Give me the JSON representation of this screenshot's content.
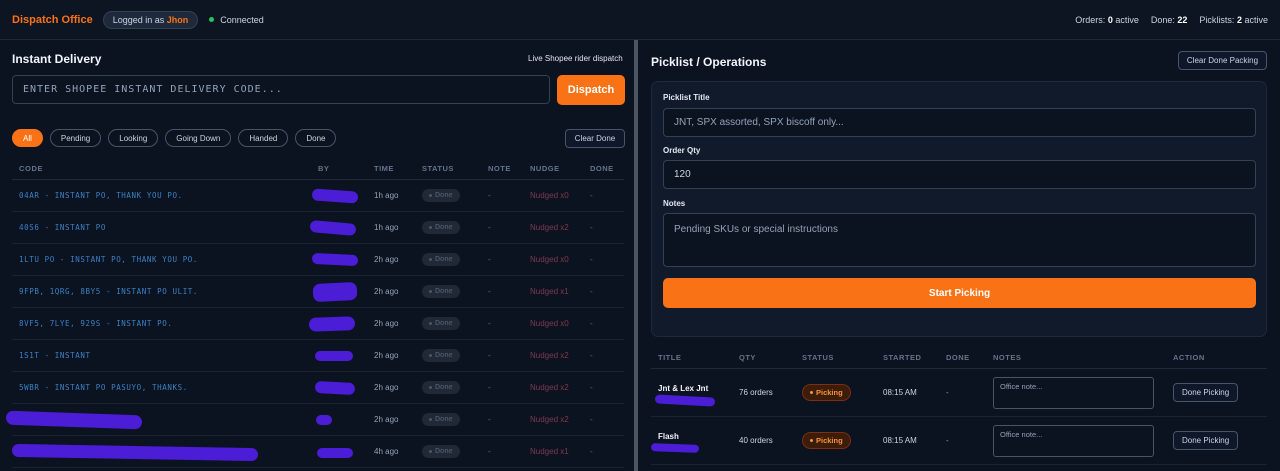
{
  "header": {
    "brand": "Dispatch Office",
    "login_prefix": "Logged in as",
    "user": "Jhon",
    "connection": "Connected",
    "orders_label": "Orders:",
    "orders_value": "0",
    "orders_suffix": "active",
    "done_label": "Done:",
    "done_value": "22",
    "picklists_label": "Picklists:",
    "picklists_value": "2",
    "picklists_suffix": "active"
  },
  "instant": {
    "title": "Instant Delivery",
    "subtitle": "Live Shopee rider dispatch",
    "placeholder": "ENTER SHOPEE INSTANT DELIVERY CODE...",
    "dispatch_label": "Dispatch",
    "filters": [
      "All",
      "Pending",
      "Looking",
      "Going Down",
      "Handed",
      "Done"
    ],
    "clear_done_label": "Clear Done",
    "columns": [
      "CODE",
      "BY",
      "TIME",
      "STATUS",
      "NOTE",
      "NUDGE",
      "DONE"
    ],
    "rows": [
      {
        "code": "04AR - INSTANT PO, THANK YOU PO.",
        "time": "1h ago",
        "status": "Done",
        "note": "-",
        "nudge": "Nudged x0",
        "done": "-"
      },
      {
        "code": "40S6 - INSTANT PO",
        "time": "1h ago",
        "status": "Done",
        "note": "-",
        "nudge": "Nudged x2",
        "done": "-"
      },
      {
        "code": "1LTU PO - INSTANT PO, THANK YOU PO.",
        "time": "2h ago",
        "status": "Done",
        "note": "-",
        "nudge": "Nudged x0",
        "done": "-"
      },
      {
        "code": "9FPB, 1QRG, 8BY5 - INSTANT PO ULIT.",
        "time": "2h ago",
        "status": "Done",
        "note": "-",
        "nudge": "Nudged x1",
        "done": "-"
      },
      {
        "code": "8VF5, 7LYE, 929S - INSTANT PO.",
        "time": "2h ago",
        "status": "Done",
        "note": "-",
        "nudge": "Nudged x0",
        "done": "-"
      },
      {
        "code": "1S1T - INSTANT",
        "time": "2h ago",
        "status": "Done",
        "note": "-",
        "nudge": "Nudged x2",
        "done": "-"
      },
      {
        "code": "5WBR - INSTANT PO PASUYO, THANKS.",
        "time": "2h ago",
        "status": "Done",
        "note": "-",
        "nudge": "Nudged x2",
        "done": "-"
      },
      {
        "code": "",
        "time": "2h ago",
        "status": "Done",
        "note": "-",
        "nudge": "Nudged x2",
        "done": "-"
      },
      {
        "code": "",
        "time": "4h ago",
        "status": "Done",
        "note": "-",
        "nudge": "Nudged x1",
        "done": "-"
      }
    ]
  },
  "picklist": {
    "title": "Picklist / Operations",
    "clear_done_label": "Clear Done Packing",
    "title_label": "Picklist Title",
    "title_placeholder": "JNT, SPX assorted, SPX biscoff only...",
    "qty_label": "Order Qty",
    "qty_value": "120",
    "notes_label": "Notes",
    "notes_placeholder": "Pending SKUs or special instructions",
    "start_label": "Start Picking",
    "columns": [
      "TITLE",
      "QTY",
      "STATUS",
      "STARTED",
      "DONE",
      "NOTES",
      "ACTION"
    ],
    "rows": [
      {
        "title": "Jnt & Lex Jnt",
        "qty": "76 orders",
        "status": "Picking",
        "started": "08:15 AM",
        "done": "-",
        "note_placeholder": "Office note...",
        "action": "Done Picking"
      },
      {
        "title": "Flash",
        "qty": "40 orders",
        "status": "Picking",
        "started": "08:15 AM",
        "done": "-",
        "note_placeholder": "Office note...",
        "action": "Done Picking"
      }
    ]
  },
  "colors": {
    "accent": "#f97316",
    "background": "#0b1220",
    "connected": "#22c55e",
    "redaction": "#4c1dd6"
  }
}
